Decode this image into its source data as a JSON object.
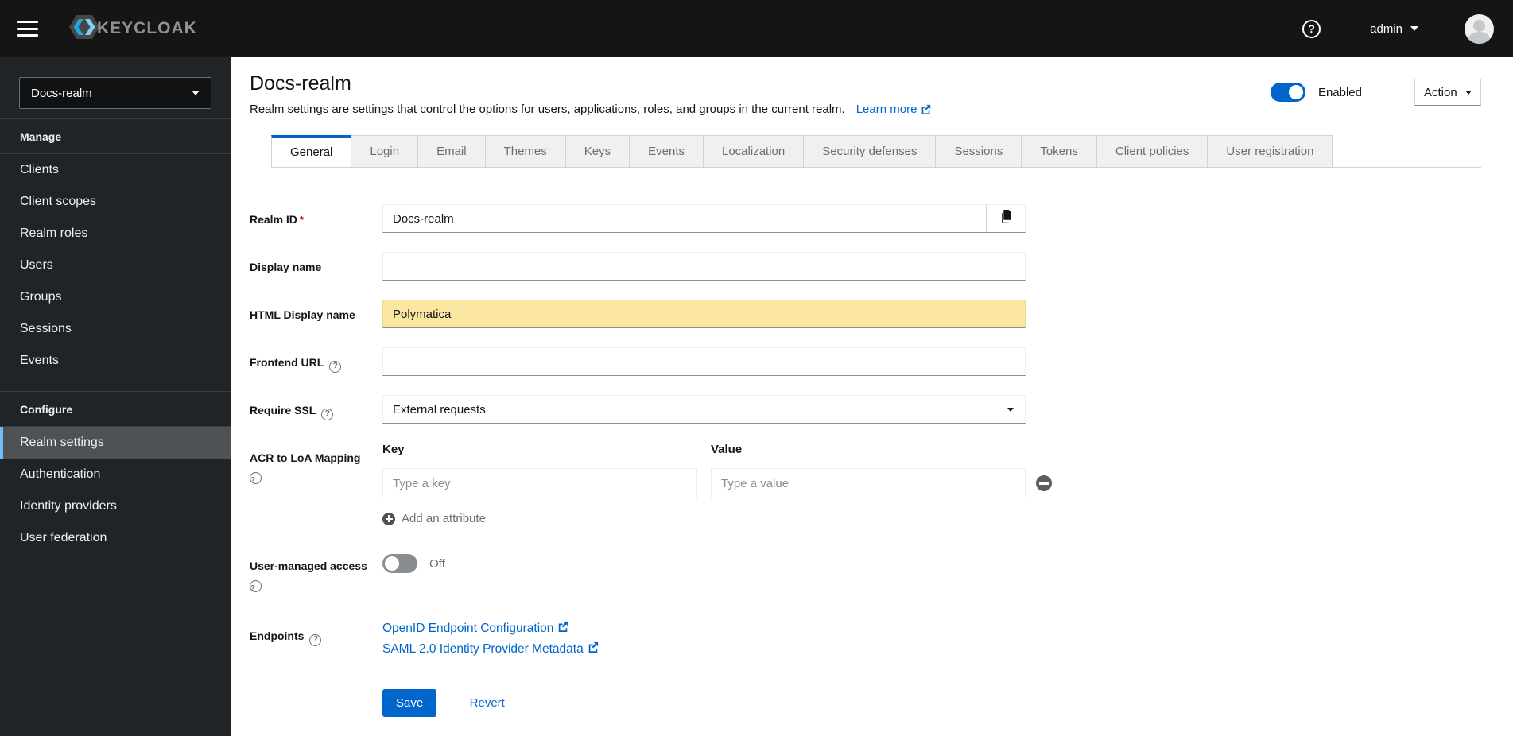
{
  "masthead": {
    "brand": "KEYCLOAK",
    "user": "admin"
  },
  "sidebar": {
    "realm_selector": "Docs-realm",
    "sections": [
      {
        "label": "Manage",
        "items": [
          {
            "label": "Clients"
          },
          {
            "label": "Client scopes"
          },
          {
            "label": "Realm roles"
          },
          {
            "label": "Users"
          },
          {
            "label": "Groups"
          },
          {
            "label": "Sessions"
          },
          {
            "label": "Events"
          }
        ]
      },
      {
        "label": "Configure",
        "items": [
          {
            "label": "Realm settings",
            "selected": true
          },
          {
            "label": "Authentication"
          },
          {
            "label": "Identity providers"
          },
          {
            "label": "User federation"
          }
        ]
      }
    ]
  },
  "header": {
    "title": "Docs-realm",
    "description": "Realm settings are settings that control the options for users, applications, roles, and groups in the current realm.",
    "learn_more": "Learn more",
    "enabled_label": "Enabled",
    "action_label": "Action"
  },
  "tabs": [
    {
      "label": "General",
      "active": true
    },
    {
      "label": "Login"
    },
    {
      "label": "Email"
    },
    {
      "label": "Themes"
    },
    {
      "label": "Keys"
    },
    {
      "label": "Events"
    },
    {
      "label": "Localization"
    },
    {
      "label": "Security defenses"
    },
    {
      "label": "Sessions"
    },
    {
      "label": "Tokens"
    },
    {
      "label": "Client policies"
    },
    {
      "label": "User registration"
    }
  ],
  "form": {
    "realm_id": {
      "label": "Realm ID",
      "required": "*",
      "value": "Docs-realm"
    },
    "display_name": {
      "label": "Display name",
      "value": ""
    },
    "html_display_name": {
      "label": "HTML Display name",
      "value": "Polymatica"
    },
    "frontend_url": {
      "label": "Frontend URL",
      "value": ""
    },
    "require_ssl": {
      "label": "Require SSL",
      "value": "External requests"
    },
    "acr_loa": {
      "label": "ACR to LoA Mapping",
      "key_header": "Key",
      "value_header": "Value",
      "key_placeholder": "Type a key",
      "value_placeholder": "Type a value",
      "add_label": "Add an attribute"
    },
    "uma": {
      "label": "User-managed access",
      "state": "Off"
    },
    "endpoints": {
      "label": "Endpoints",
      "links": [
        {
          "label": "OpenID Endpoint Configuration"
        },
        {
          "label": "SAML 2.0 Identity Provider Metadata"
        }
      ]
    },
    "save_label": "Save",
    "revert_label": "Revert"
  },
  "colors": {
    "accent": "#0066cc",
    "masthead_bg": "#151515",
    "sidebar_bg": "#212427",
    "nav_selected_bg": "#4f5255",
    "nav_selected_accent": "#73bcf7",
    "autofill_highlight": "#fae6a0",
    "required_red": "#c9190b"
  }
}
